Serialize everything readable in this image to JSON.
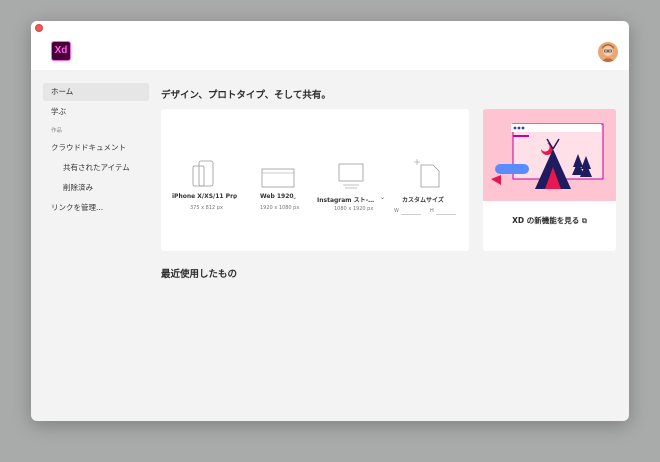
{
  "app": {
    "logo_text": "Xd",
    "brand_color": "#ff61f6",
    "brand_bg": "#470137"
  },
  "sidebar": {
    "items": [
      {
        "label": "ホーム",
        "active": true
      },
      {
        "label": "学ぶ"
      }
    ],
    "section_label": "作品",
    "work_items": [
      {
        "label": "クラウドドキュメント"
      },
      {
        "label": "共有されたアイテム"
      },
      {
        "label": "削除済み"
      }
    ],
    "manage_links_label": "リンクを管理..."
  },
  "main": {
    "title": "デザイン、プロトタイプ、そして共有。",
    "presets": [
      {
        "label": "iPhone X/XS/11 Pro",
        "size": "375 x 812 px",
        "icon": "phone-icon"
      },
      {
        "label": "Web 1920",
        "size": "1920 x 1080 px",
        "icon": "web-icon"
      },
      {
        "label": "Instagram スト-…",
        "size": "1080 x 1920 px",
        "icon": "instagram-story-icon"
      },
      {
        "label": "カスタムサイズ",
        "width_label": "W",
        "height_label": "H",
        "icon": "custom-size-icon"
      }
    ],
    "feature": {
      "link_label": "XD の新機能を見る",
      "art_color": "#ffc4d2",
      "dots_active_index": 0,
      "dots_count": 3
    },
    "recent_title": "最近使用したもの"
  }
}
